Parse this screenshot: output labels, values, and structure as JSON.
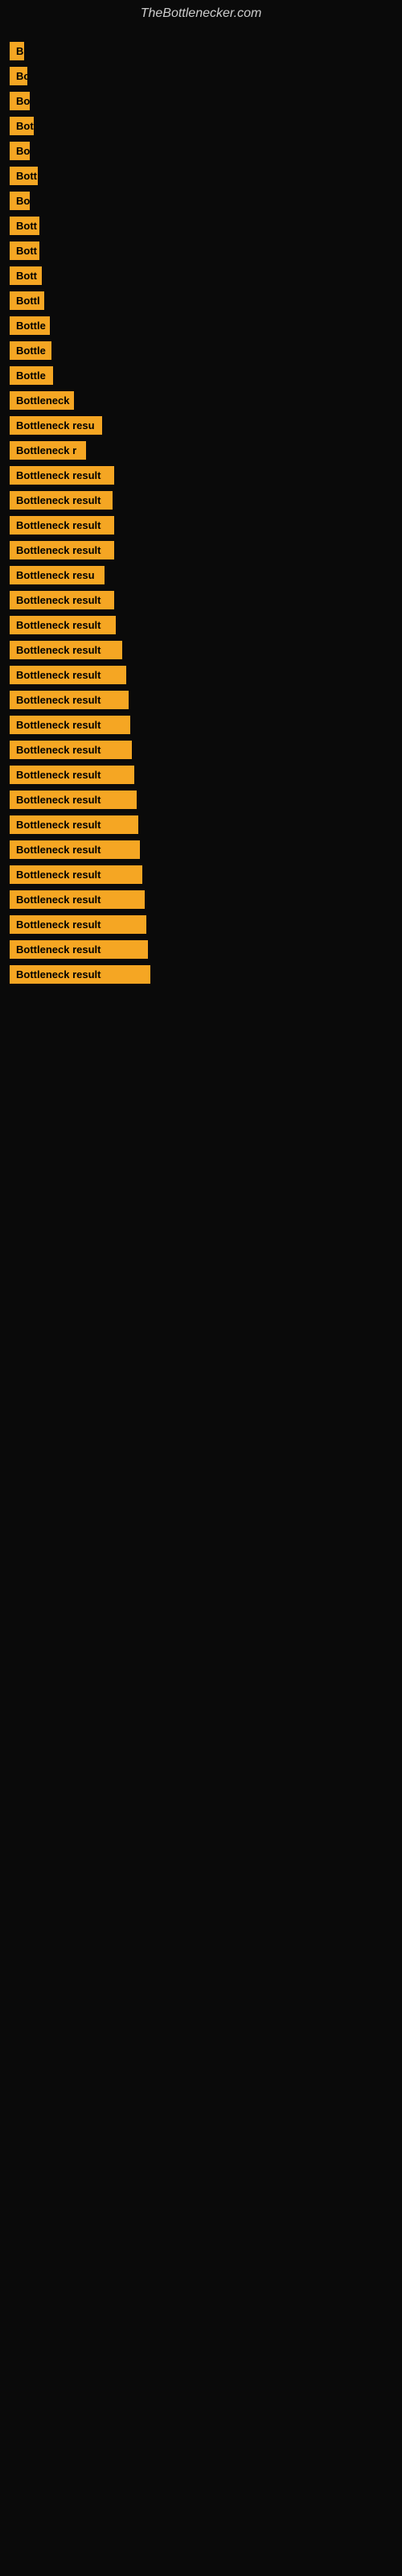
{
  "site": {
    "title": "TheBottlenecker.com"
  },
  "items": [
    {
      "label": "B",
      "width": 18
    },
    {
      "label": "Bo",
      "width": 22
    },
    {
      "label": "Bo",
      "width": 25
    },
    {
      "label": "Bot",
      "width": 30
    },
    {
      "label": "Bo",
      "width": 25
    },
    {
      "label": "Bott",
      "width": 35
    },
    {
      "label": "Bo",
      "width": 25
    },
    {
      "label": "Bott",
      "width": 37
    },
    {
      "label": "Bott",
      "width": 37
    },
    {
      "label": "Bott",
      "width": 40
    },
    {
      "label": "Bottl",
      "width": 43
    },
    {
      "label": "Bottle",
      "width": 50
    },
    {
      "label": "Bottle",
      "width": 52
    },
    {
      "label": "Bottle",
      "width": 54
    },
    {
      "label": "Bottleneck",
      "width": 80
    },
    {
      "label": "Bottleneck resu",
      "width": 115
    },
    {
      "label": "Bottleneck r",
      "width": 95
    },
    {
      "label": "Bottleneck result",
      "width": 130
    },
    {
      "label": "Bottleneck result",
      "width": 128
    },
    {
      "label": "Bottleneck result",
      "width": 130
    },
    {
      "label": "Bottleneck result",
      "width": 130
    },
    {
      "label": "Bottleneck resu",
      "width": 118
    },
    {
      "label": "Bottleneck result",
      "width": 130
    },
    {
      "label": "Bottleneck result",
      "width": 132
    },
    {
      "label": "Bottleneck result",
      "width": 140
    },
    {
      "label": "Bottleneck result",
      "width": 145
    },
    {
      "label": "Bottleneck result",
      "width": 148
    },
    {
      "label": "Bottleneck result",
      "width": 150
    },
    {
      "label": "Bottleneck result",
      "width": 152
    },
    {
      "label": "Bottleneck result",
      "width": 155
    },
    {
      "label": "Bottleneck result",
      "width": 158
    },
    {
      "label": "Bottleneck result",
      "width": 160
    },
    {
      "label": "Bottleneck result",
      "width": 162
    },
    {
      "label": "Bottleneck result",
      "width": 165
    },
    {
      "label": "Bottleneck result",
      "width": 168
    },
    {
      "label": "Bottleneck result",
      "width": 170
    },
    {
      "label": "Bottleneck result",
      "width": 172
    },
    {
      "label": "Bottleneck result",
      "width": 175
    }
  ]
}
